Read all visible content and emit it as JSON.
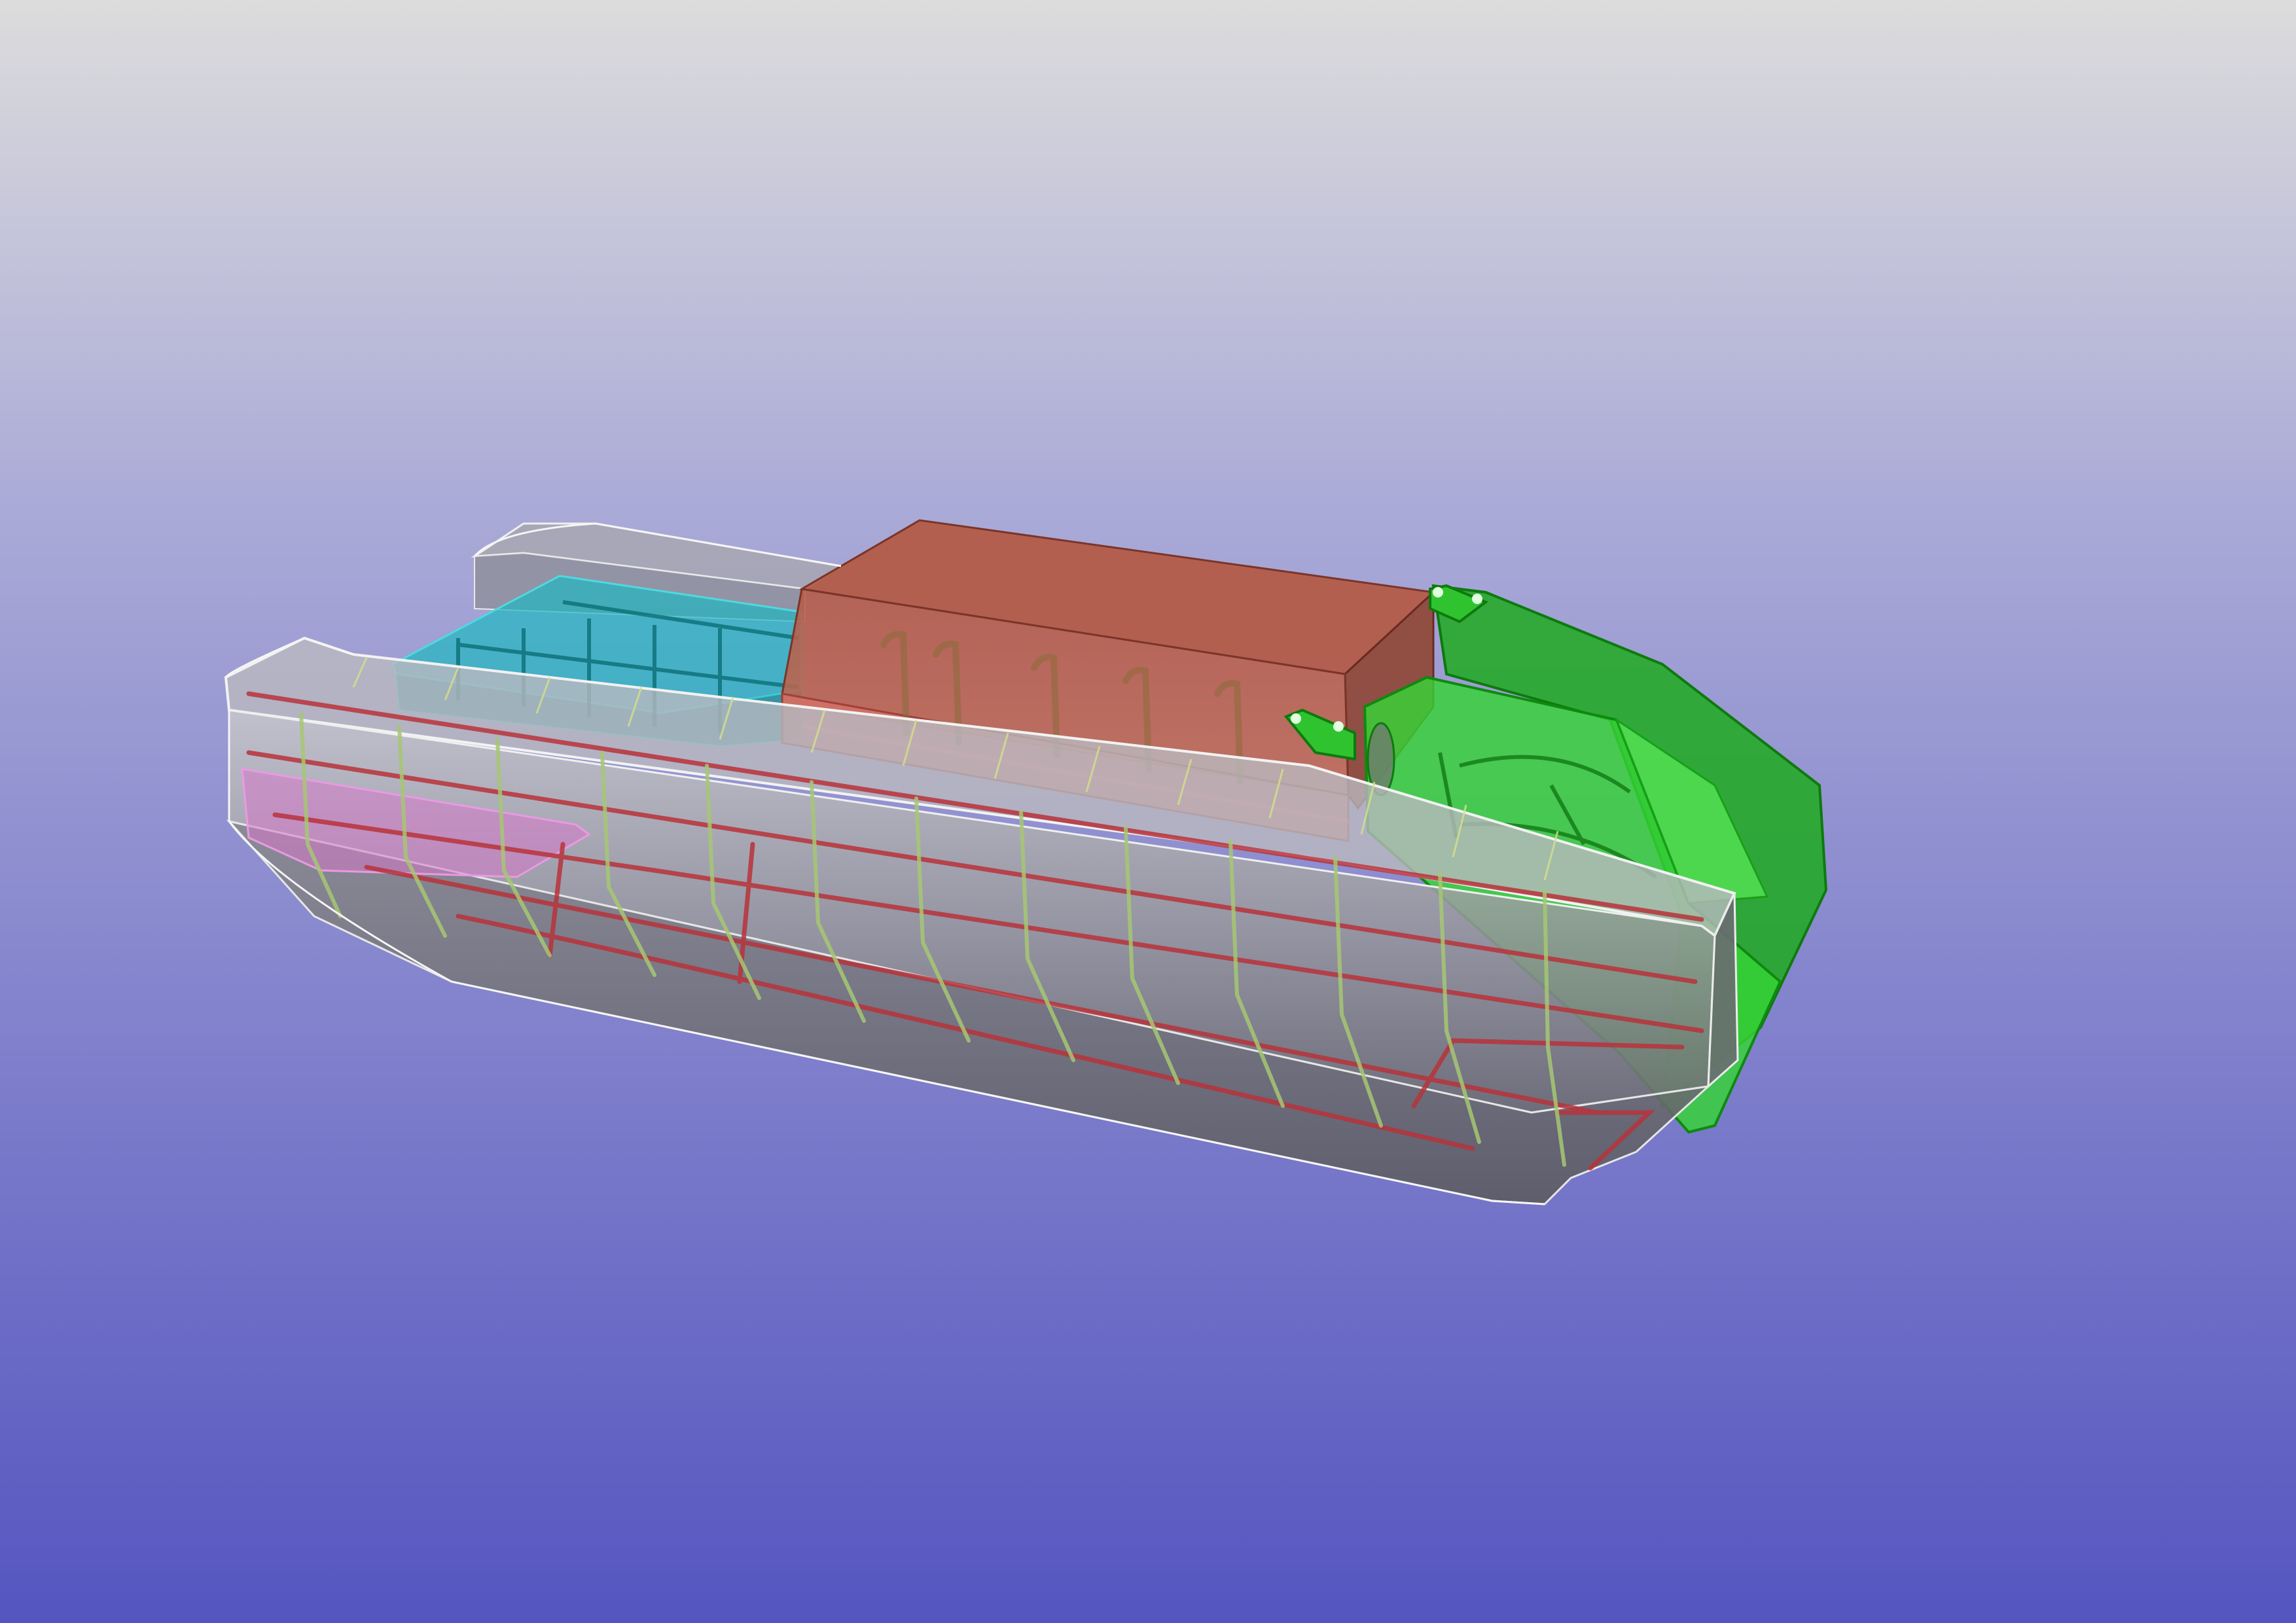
{
  "viewport": {
    "background_top": "#dcdcdc",
    "background_mid": "#a9a9d6",
    "background_bottom": "#5555c0"
  },
  "model": {
    "hull_color": "#9a9a9a",
    "edge_color": "#f0f0f0",
    "frame_color": "#a6c773",
    "stringer_color": "#c0393b",
    "tank_color": "#1fb8c0",
    "deckhouse_color": "#c45b44",
    "bow_structure_color": "#22cc22",
    "pink_tank_color": "#d678c8"
  }
}
